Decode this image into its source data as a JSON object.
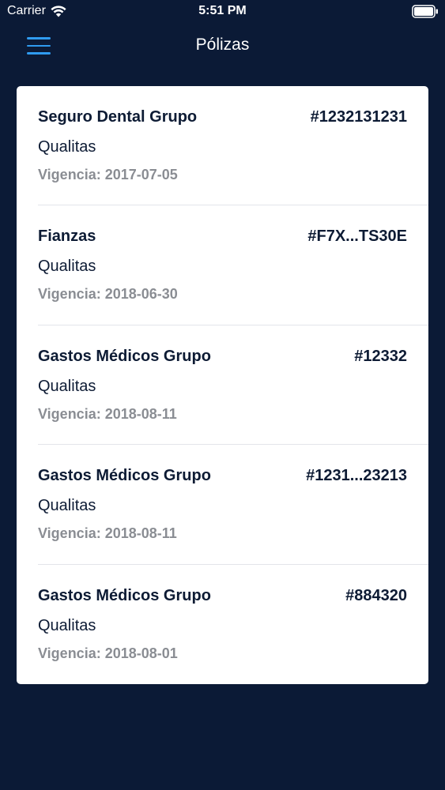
{
  "status_bar": {
    "carrier": "Carrier",
    "time": "5:51 PM"
  },
  "nav": {
    "title": "Pólizas"
  },
  "policies": [
    {
      "name": "Seguro Dental Grupo",
      "number": "#1232131231",
      "company": "Qualitas",
      "validity": "Vigencia: 2017-07-05"
    },
    {
      "name": "Fianzas",
      "number": "#F7X...TS30E",
      "company": "Qualitas",
      "validity": "Vigencia: 2018-06-30"
    },
    {
      "name": "Gastos Médicos Grupo",
      "number": "#12332",
      "company": "Qualitas",
      "validity": "Vigencia: 2018-08-11"
    },
    {
      "name": "Gastos Médicos Grupo",
      "number": "#1231...23213",
      "company": "Qualitas",
      "validity": "Vigencia: 2018-08-11"
    },
    {
      "name": "Gastos Médicos Grupo",
      "number": "#884320",
      "company": "Qualitas",
      "validity": "Vigencia: 2018-08-01"
    }
  ],
  "colors": {
    "background": "#0b1a36",
    "accent": "#2f9bf0",
    "card": "#ffffff",
    "text_primary": "#0d1b34",
    "text_secondary": "#8a8d93"
  },
  "icons": {
    "menu": "hamburger-menu-icon",
    "wifi": "wifi-icon",
    "battery": "battery-icon"
  }
}
